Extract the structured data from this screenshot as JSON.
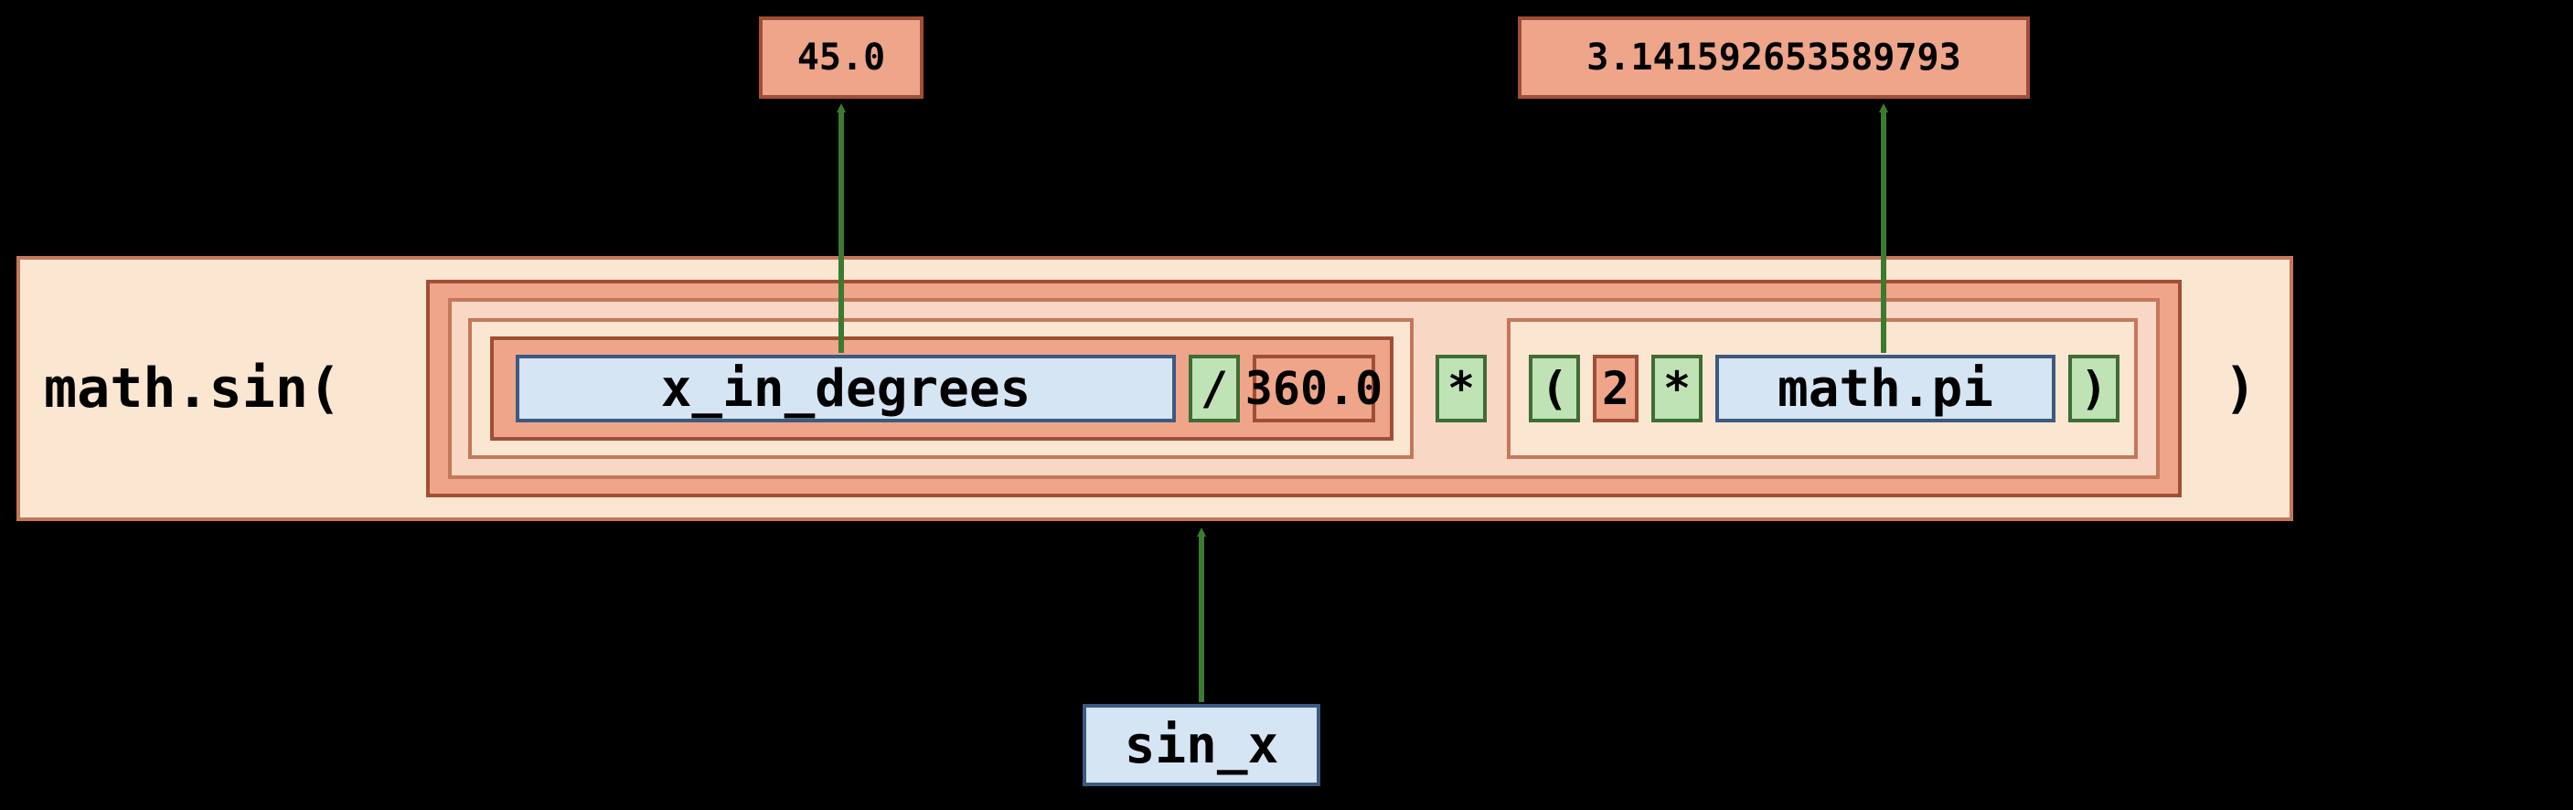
{
  "diagram": {
    "top_value_left": "45.0",
    "top_value_right": "3.141592653589793",
    "func_open": "math.sin(",
    "var_degrees": "x_in_degrees",
    "op_div": "/",
    "lit_360": "360.0",
    "op_mul1": "*",
    "paren_open": "(",
    "lit_2": "2",
    "op_mul2": "*",
    "var_pi": "math.pi",
    "paren_close": ")",
    "func_close": ")",
    "bottom_label": "sin_x",
    "colors": {
      "blue_fill": "#d6e5f3",
      "blue_border": "#3d5a80",
      "salmon_fill": "#eea58a",
      "salmon_border": "#a04f36",
      "cream_fill": "#fbe6d2",
      "cream_border": "#c47759",
      "green_fill": "#c0e3b5",
      "green_border": "#3f6d34",
      "arrow": "#3c7a2f"
    }
  }
}
